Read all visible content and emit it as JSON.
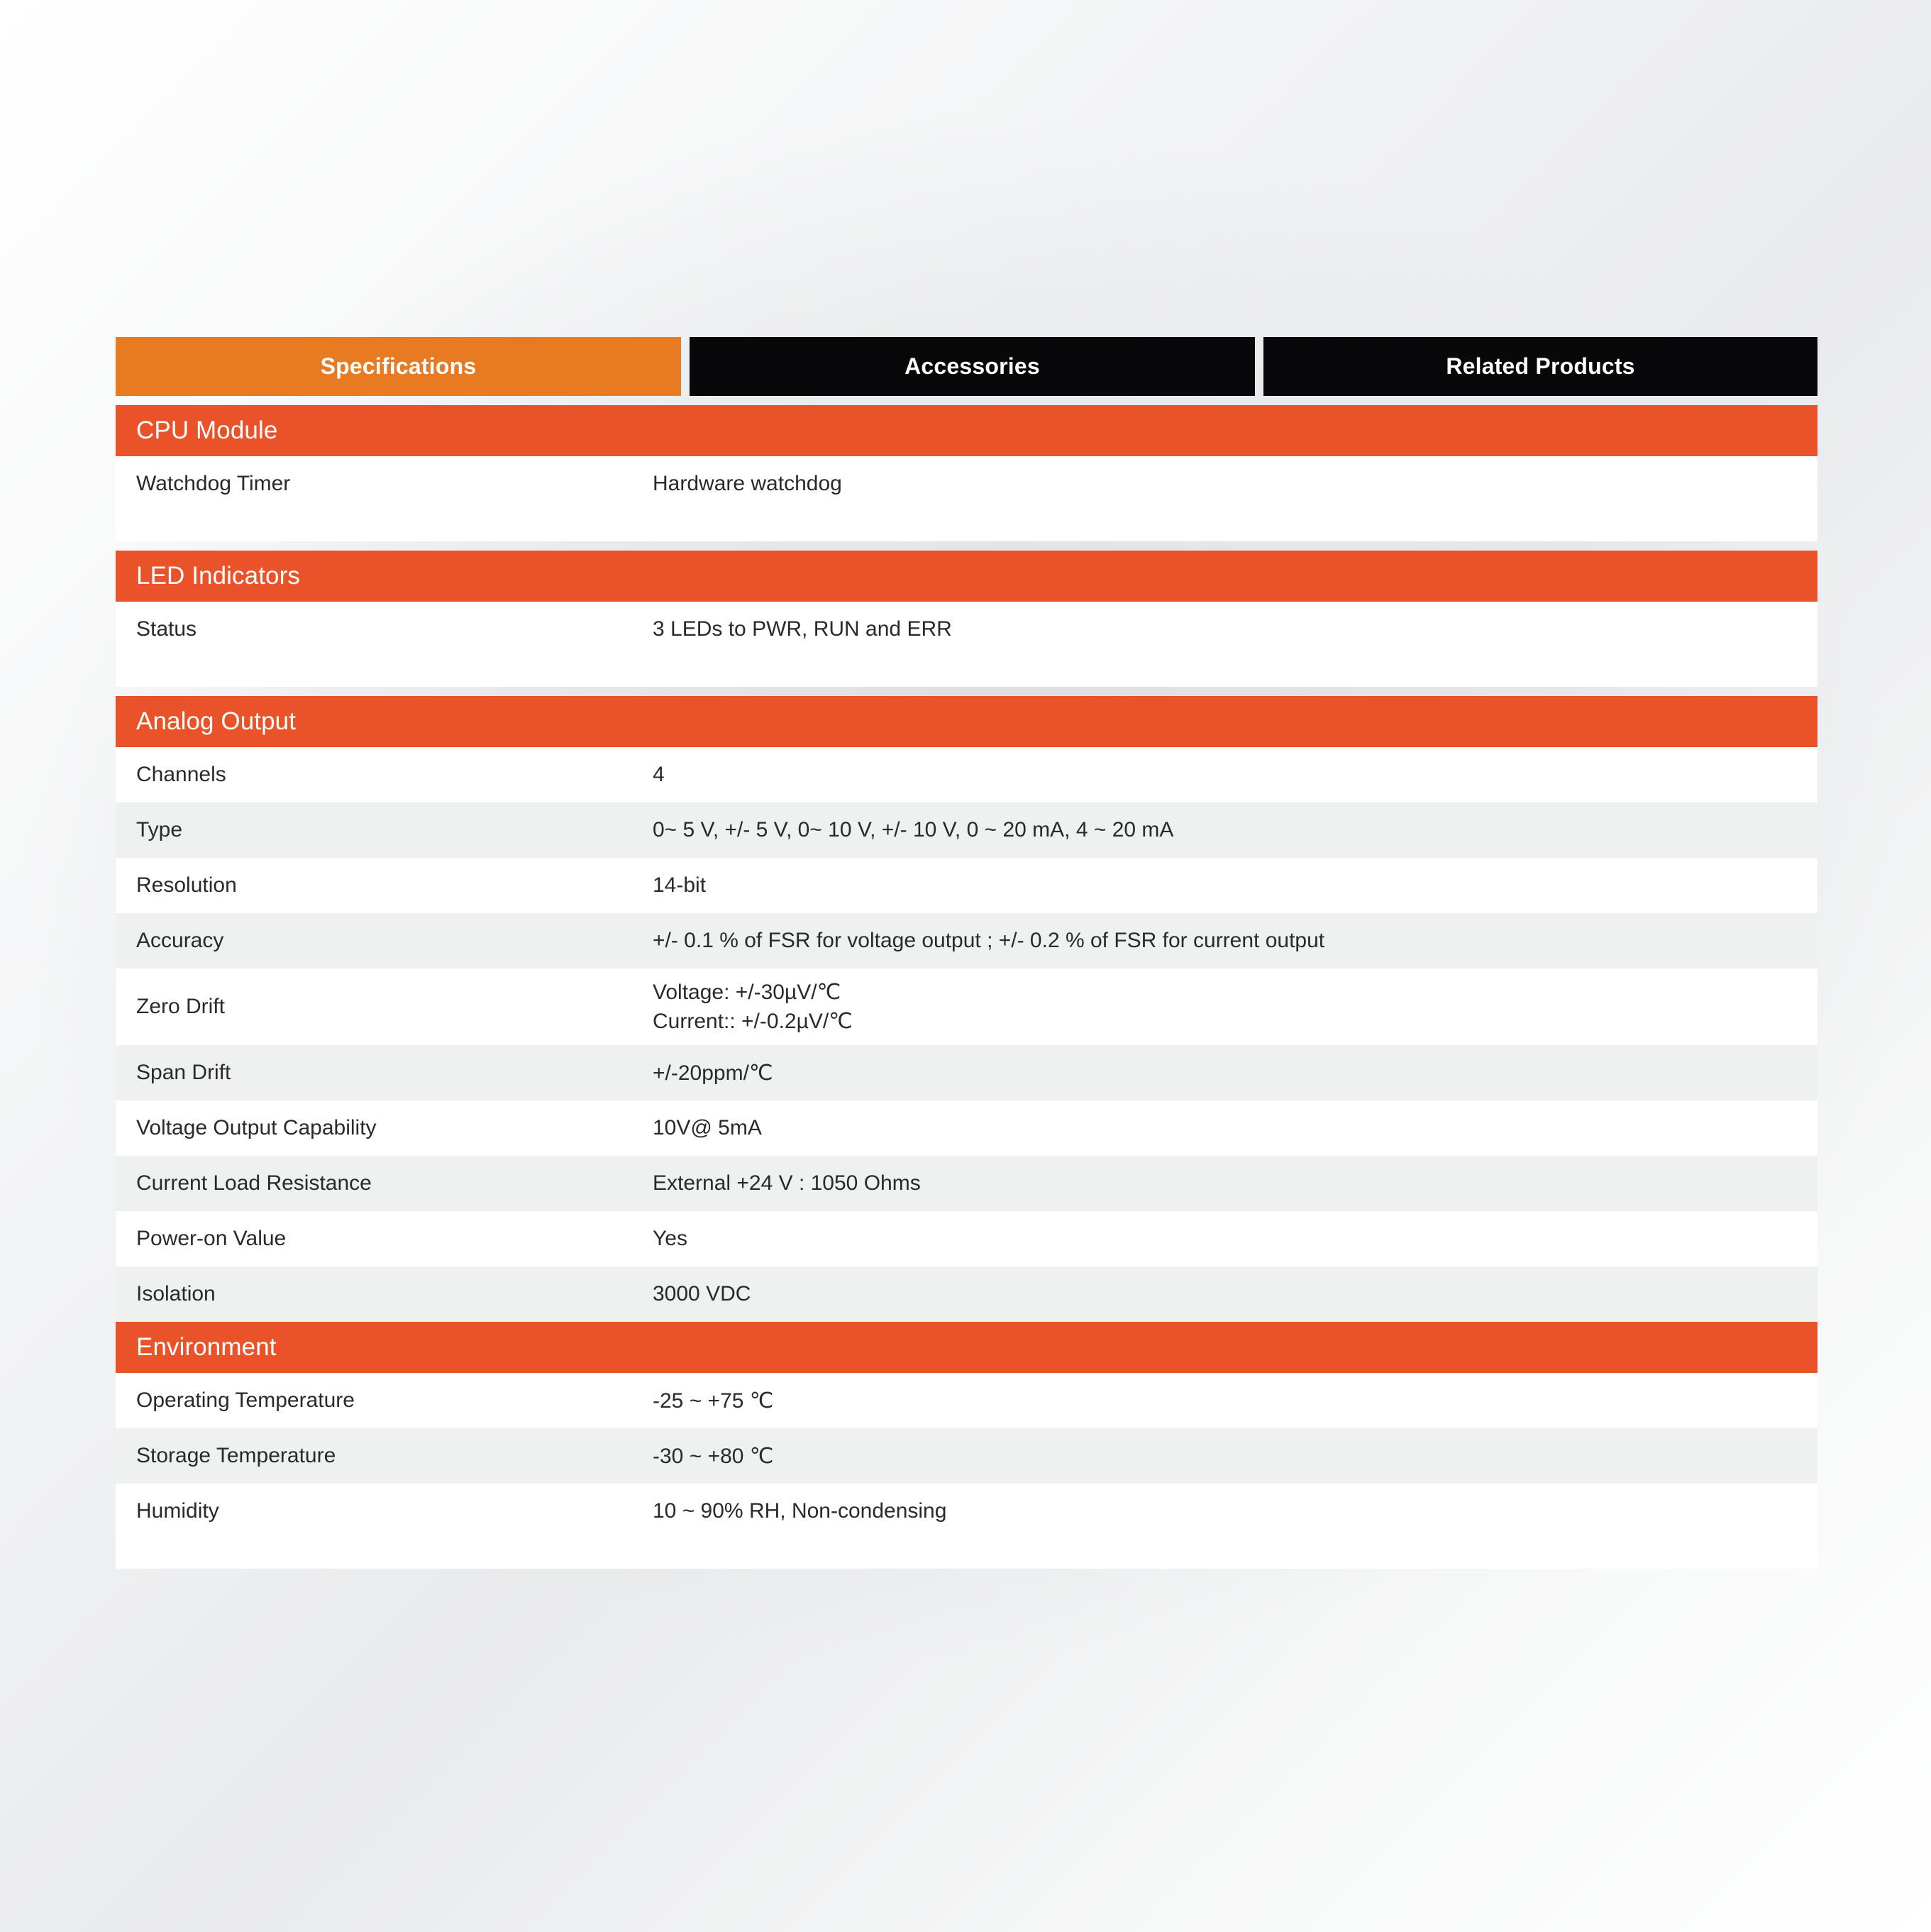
{
  "tabs": [
    {
      "label": "Specifications",
      "active": true,
      "bg": "#E87B22"
    },
    {
      "label": "Accessories",
      "active": false,
      "bg": "#08080A"
    },
    {
      "label": "Related Products",
      "active": false,
      "bg": "#08080A"
    }
  ],
  "colors": {
    "tab_active": "#E87B22",
    "tab_inactive": "#08080A",
    "section_header": "#EA5329",
    "row_stripe": "#EFF0F0",
    "row_plain": "#FFFFFF",
    "text": "#2A2A2A"
  },
  "sections": [
    {
      "title": "CPU Module",
      "rows": [
        {
          "label": "Watchdog Timer",
          "value": "Hardware watchdog"
        }
      ]
    },
    {
      "title": "LED Indicators",
      "rows": [
        {
          "label": "Status",
          "value": "3 LEDs to PWR, RUN and ERR"
        }
      ]
    },
    {
      "title": "Analog Output",
      "rows": [
        {
          "label": "Channels",
          "value": "4"
        },
        {
          "label": "Type",
          "value": "0~ 5 V, +/- 5 V, 0~ 10 V, +/- 10 V, 0 ~ 20 mA, 4 ~ 20 mA"
        },
        {
          "label": "Resolution",
          "value": "14-bit"
        },
        {
          "label": "Accuracy",
          "value": "+/- 0.1 % of FSR for voltage output ; +/- 0.2 % of FSR for current output"
        },
        {
          "label": "Zero Drift",
          "value": "Voltage: +/-30µV/℃",
          "value2": "Current:: +/-0.2µV/℃"
        },
        {
          "label": "Span Drift",
          "value": "+/-20ppm/℃"
        },
        {
          "label": "Voltage Output Capability",
          "value": "10V@ 5mA"
        },
        {
          "label": "Current Load Resistance",
          "value": "External +24 V : 1050 Ohms"
        },
        {
          "label": "Power-on Value",
          "value": "Yes"
        },
        {
          "label": "Isolation",
          "value": "3000 VDC"
        }
      ]
    },
    {
      "title": "Environment",
      "rows": [
        {
          "label": "Operating Temperature",
          "value": "-25 ~ +75 ℃"
        },
        {
          "label": "Storage Temperature",
          "value": "-30 ~ +80 ℃"
        },
        {
          "label": "Humidity",
          "value": "10 ~ 90% RH, Non-condensing"
        }
      ]
    }
  ]
}
